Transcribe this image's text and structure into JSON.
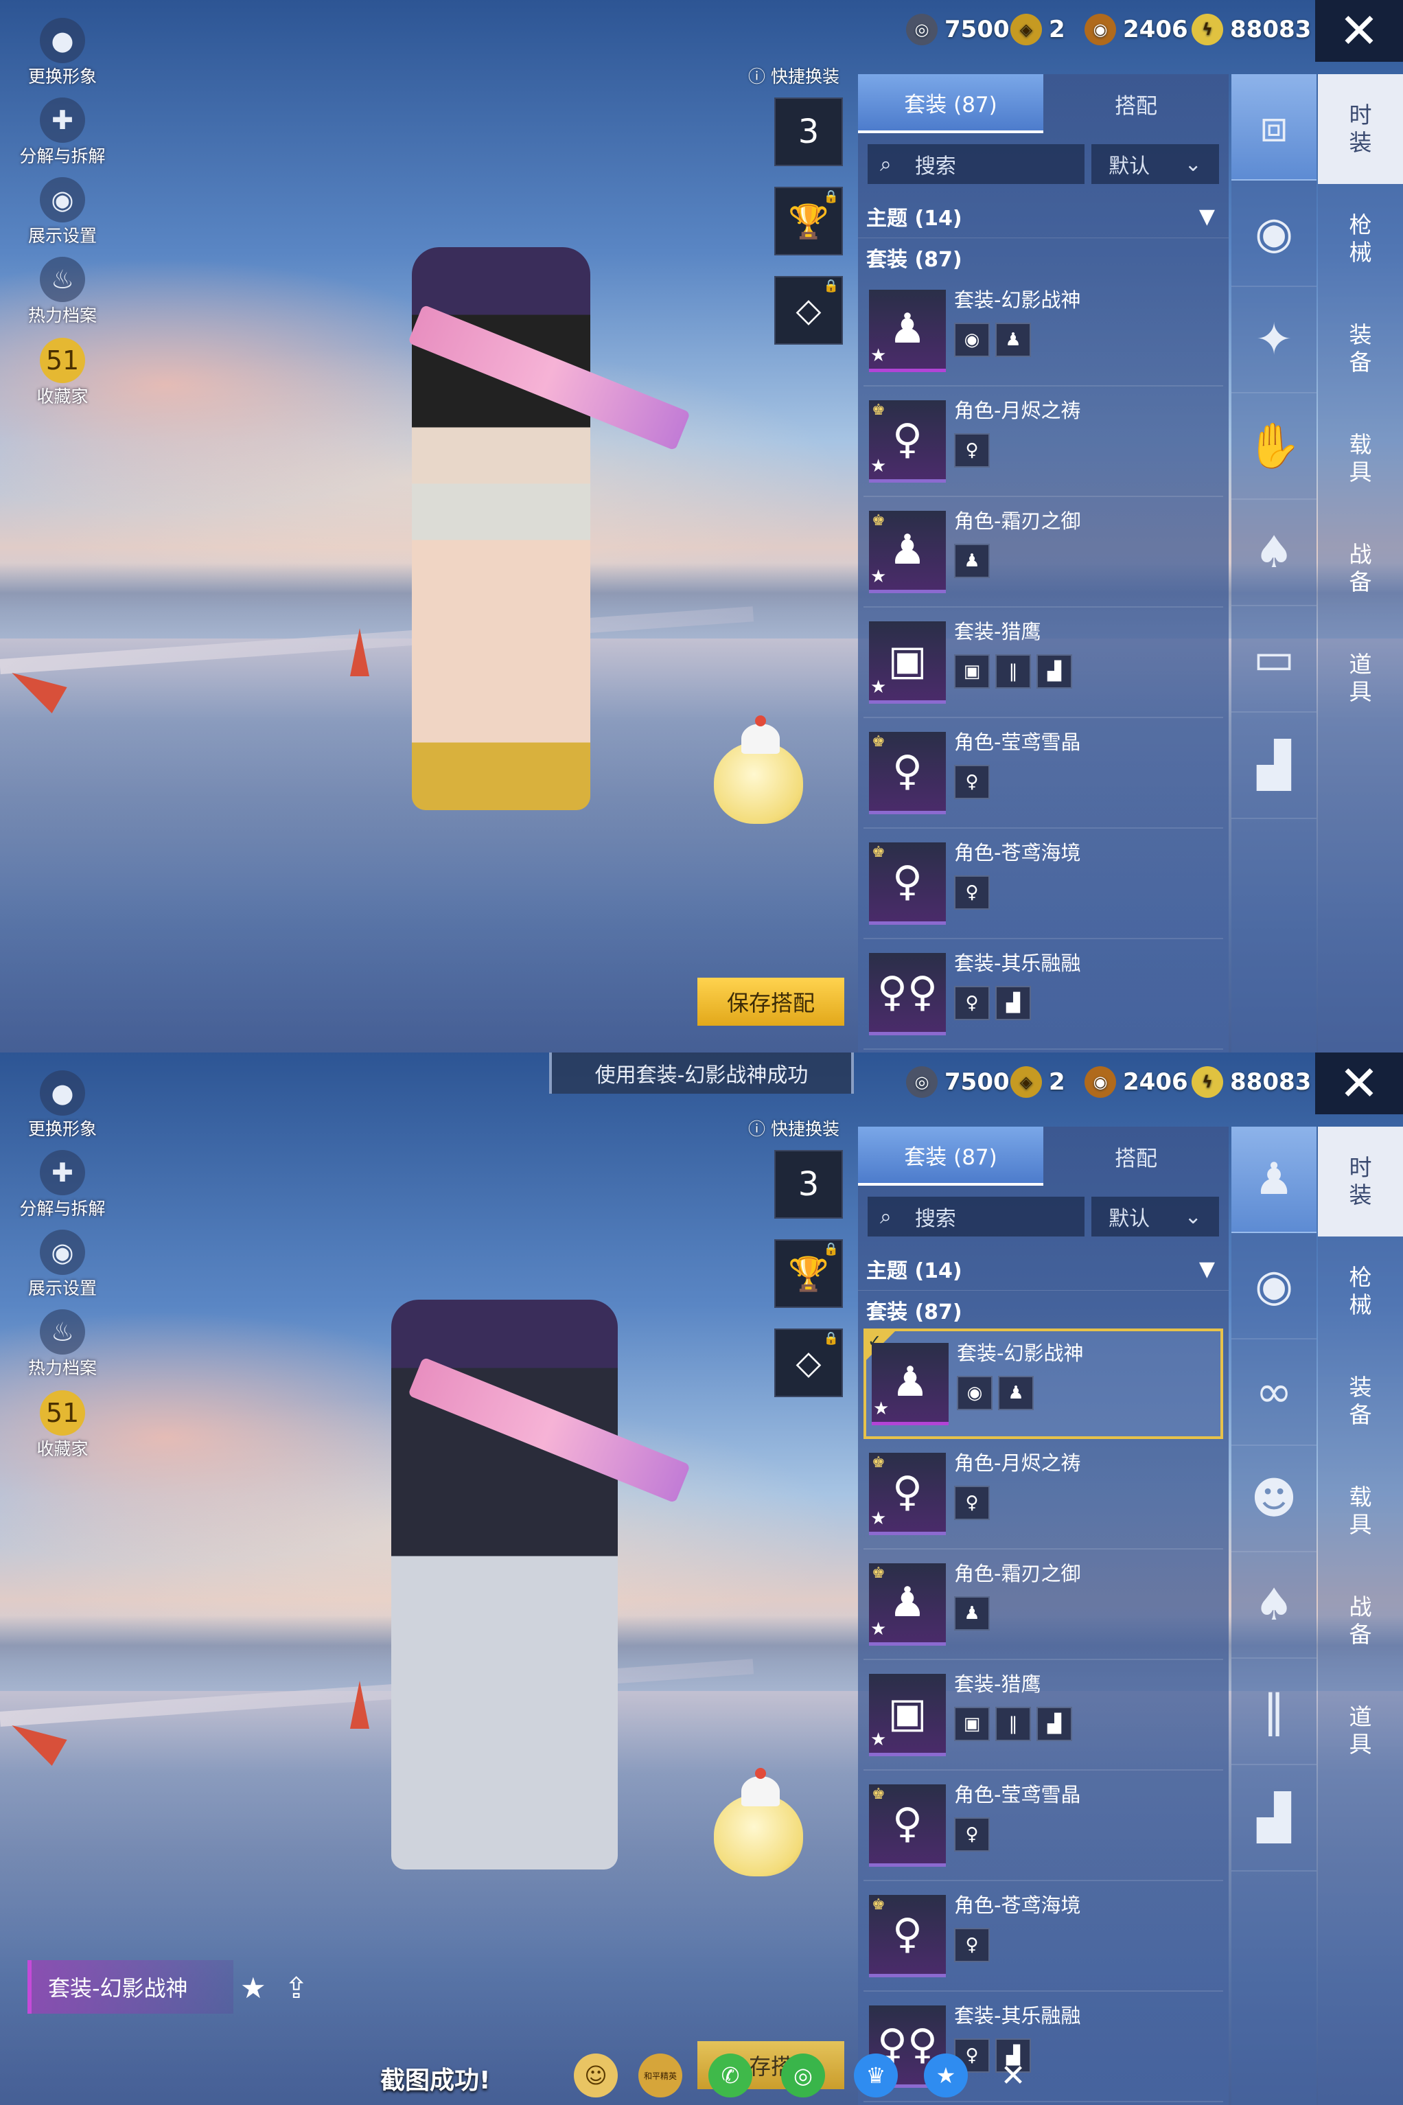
{
  "currency": {
    "c1": "7500",
    "c2": "2",
    "c3": "2406",
    "c4": "88083"
  },
  "left_menu": [
    {
      "label": "更换形象",
      "icon": "person-icon"
    },
    {
      "label": "分解与拆解",
      "icon": "puzzle-icon"
    },
    {
      "label": "展示设置",
      "icon": "eye-icon"
    },
    {
      "label": "热力档案",
      "icon": "flame-icon"
    },
    {
      "label": "收藏家",
      "icon": "collector-badge-icon"
    }
  ],
  "quick_change": "快捷换装",
  "quick_slots": [
    "3"
  ],
  "tabs": {
    "outfits": "套装 (87)",
    "match": "搭配"
  },
  "search": {
    "label": "搜索",
    "sort": "默认"
  },
  "section": {
    "theme": "主题 (14)",
    "outfits": "套装 (87)"
  },
  "items": [
    {
      "name": "套装-幻影战神"
    },
    {
      "name": "角色-月烬之祷"
    },
    {
      "name": "角色-霜刃之御"
    },
    {
      "name": "套装-猎鹰"
    },
    {
      "name": "角色-莹鸢雪晶"
    },
    {
      "name": "角色-苍鸢海境"
    },
    {
      "name": "套装-其乐融融"
    }
  ],
  "categories": [
    "时\n装",
    "枪\n械",
    "装\n备",
    "载\n具",
    "战\n备",
    "道\n具"
  ],
  "save_button": "保存搭配",
  "toast": "使用套装-幻影战神成功",
  "current_outfit": "套装-幻影战神",
  "screenshot_msg": "截图成功!",
  "share_badge": "和平精英",
  "bottom_button_partial": "存搭"
}
